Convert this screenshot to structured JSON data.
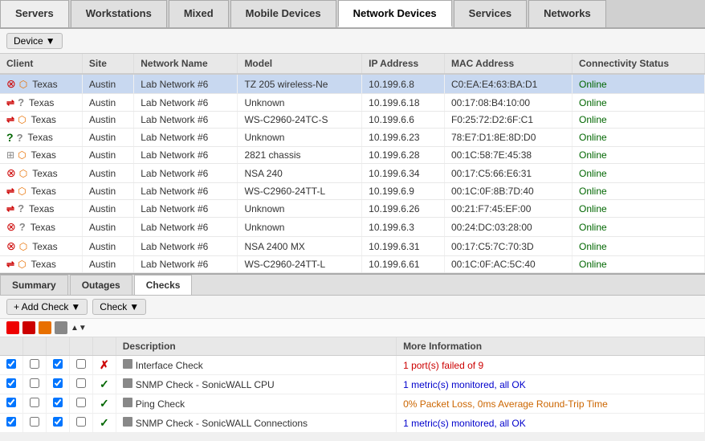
{
  "tabs": [
    {
      "label": "Servers",
      "active": false
    },
    {
      "label": "Workstations",
      "active": false
    },
    {
      "label": "Mixed",
      "active": false
    },
    {
      "label": "Mobile Devices",
      "active": false
    },
    {
      "label": "Network Devices",
      "active": true
    },
    {
      "label": "Services",
      "active": false
    },
    {
      "label": "Networks",
      "active": false
    }
  ],
  "toolbar": {
    "device_label": "Device",
    "dropdown_arrow": "▼"
  },
  "table": {
    "columns": [
      "Client",
      "Site",
      "Network Name",
      "Model",
      "IP Address",
      "MAC Address",
      "Connectivity Status"
    ],
    "rows": [
      {
        "icon1": "router-red",
        "icon2": "cube",
        "client": "Texas",
        "site": "Austin",
        "network": "Lab Network #6",
        "model": "TZ 205 wireless-Ne",
        "ip": "10.199.6.8",
        "mac": "C0:EA:E4:63:BA:D1",
        "status": "Online",
        "selected": true
      },
      {
        "icon1": "switch",
        "icon2": "question",
        "client": "Texas",
        "site": "Austin",
        "network": "Lab Network #6",
        "model": "Unknown",
        "ip": "10.199.6.18",
        "mac": "00:17:08:B4:10:00",
        "status": "Online",
        "selected": false
      },
      {
        "icon1": "switch",
        "icon2": "cube",
        "client": "Texas",
        "site": "Austin",
        "network": "Lab Network #6",
        "model": "WS-C2960-24TC-S",
        "ip": "10.199.6.6",
        "mac": "F0:25:72:D2:6F:C1",
        "status": "Online",
        "selected": false
      },
      {
        "icon1": "question-green",
        "icon2": "question",
        "client": "Texas",
        "site": "Austin",
        "network": "Lab Network #6",
        "model": "Unknown",
        "ip": "10.199.6.23",
        "mac": "78:E7:D1:8E:8D:D0",
        "status": "Online",
        "selected": false
      },
      {
        "icon1": "rack",
        "icon2": "cube",
        "client": "Texas",
        "site": "Austin",
        "network": "Lab Network #6",
        "model": "2821 chassis",
        "ip": "10.199.6.28",
        "mac": "00:1C:58:7E:45:38",
        "status": "Online",
        "selected": false
      },
      {
        "icon1": "router-red",
        "icon2": "cube",
        "client": "Texas",
        "site": "Austin",
        "network": "Lab Network #6",
        "model": "NSA 240",
        "ip": "10.199.6.34",
        "mac": "00:17:C5:66:E6:31",
        "status": "Online",
        "selected": false
      },
      {
        "icon1": "switch",
        "icon2": "cube",
        "client": "Texas",
        "site": "Austin",
        "network": "Lab Network #6",
        "model": "WS-C2960-24TT-L",
        "ip": "10.199.6.9",
        "mac": "00:1C:0F:8B:7D:40",
        "status": "Online",
        "selected": false
      },
      {
        "icon1": "switch",
        "icon2": "question",
        "client": "Texas",
        "site": "Austin",
        "network": "Lab Network #6",
        "model": "Unknown",
        "ip": "10.199.6.26",
        "mac": "00:21:F7:45:EF:00",
        "status": "Online",
        "selected": false
      },
      {
        "icon1": "router-red",
        "icon2": "question",
        "client": "Texas",
        "site": "Austin",
        "network": "Lab Network #6",
        "model": "Unknown",
        "ip": "10.199.6.3",
        "mac": "00:24:DC:03:28:00",
        "status": "Online",
        "selected": false
      },
      {
        "icon1": "router-red",
        "icon2": "cube",
        "client": "Texas",
        "site": "Austin",
        "network": "Lab Network #6",
        "model": "NSA 2400 MX",
        "ip": "10.199.6.31",
        "mac": "00:17:C5:7C:70:3D",
        "status": "Online",
        "selected": false
      },
      {
        "icon1": "switch",
        "icon2": "cube",
        "client": "Texas",
        "site": "Austin",
        "network": "Lab Network #6",
        "model": "WS-C2960-24TT-L",
        "ip": "10.199.6.61",
        "mac": "00:1C:0F:AC:5C:40",
        "status": "Online",
        "selected": false
      }
    ]
  },
  "bottom": {
    "tabs": [
      {
        "label": "Summary",
        "active": false
      },
      {
        "label": "Outages",
        "active": false
      },
      {
        "label": "Checks",
        "active": true
      }
    ],
    "checks_toolbar": {
      "add_check_label": "+ Add Check",
      "dropdown_arrow": "▼",
      "check_label": "Check",
      "check_arrow": "▼"
    },
    "checks_columns": [
      "",
      "Description",
      "More Information"
    ],
    "checks": [
      {
        "status": "fail",
        "icon": "interface",
        "name": "Interface Check",
        "more": "1 port(s) failed of 9",
        "more_color": "red"
      },
      {
        "status": "ok",
        "icon": "snmp",
        "name": "SNMP Check - SonicWALL CPU",
        "more": "1 metric(s) monitored, all OK",
        "more_color": "blue"
      },
      {
        "status": "ok",
        "icon": "ping",
        "name": "Ping Check",
        "more": "0% Packet Loss, 0ms Average Round-Trip Time",
        "more_color": "orange"
      },
      {
        "status": "ok",
        "icon": "snmp",
        "name": "SNMP Check - SonicWALL Connections",
        "more": "1 metric(s) monitored, all OK",
        "more_color": "blue"
      }
    ]
  }
}
